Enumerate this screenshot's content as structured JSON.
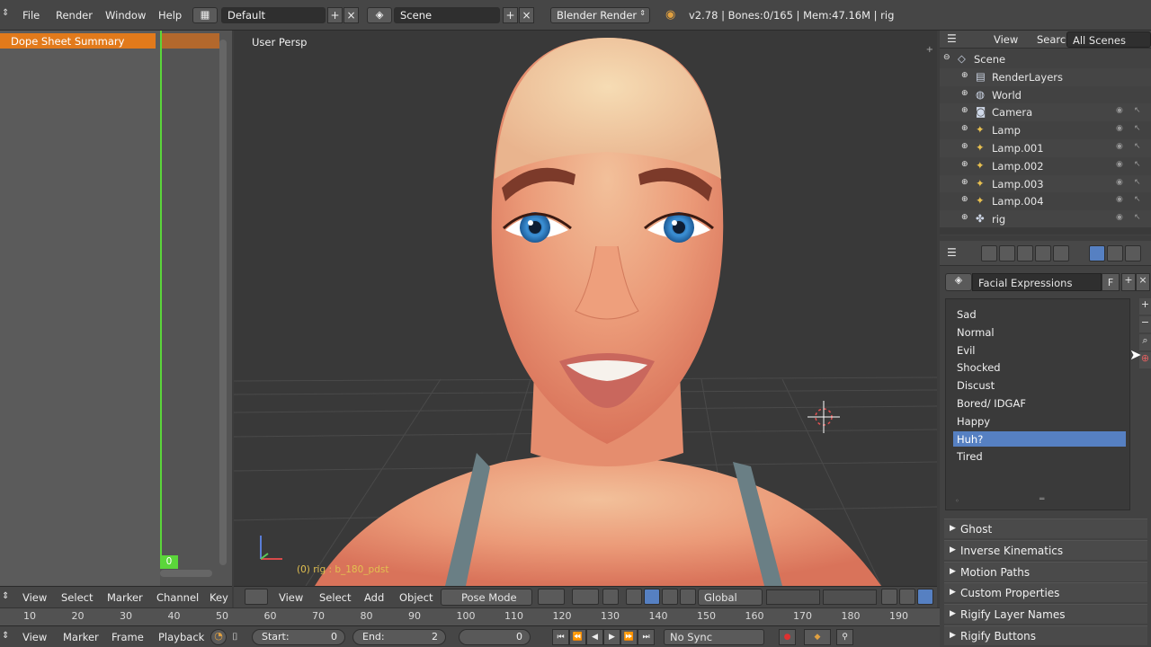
{
  "topbar": {
    "menus": [
      "File",
      "Render",
      "Window",
      "Help"
    ],
    "layout": "Default",
    "scene": "Scene",
    "engine": "Blender Render",
    "stats": "v2.78 | Bones:0/165 | Mem:47.16M | rig"
  },
  "dopesheet": {
    "summary": "Dope Sheet Summary",
    "current_frame": "0",
    "header": [
      "View",
      "Select",
      "Marker",
      "Channel",
      "Key"
    ]
  },
  "viewport": {
    "label": "User Persp",
    "bone_label": "(0) rig : b_180_pdst",
    "header": [
      "View",
      "Select",
      "Add",
      "Object"
    ],
    "mode": "Pose Mode",
    "orientation": "Global"
  },
  "outliner": {
    "header": [
      "View",
      "Search"
    ],
    "display_mode": "All Scenes",
    "items": [
      {
        "name": "Scene",
        "icon": "scene-icon",
        "indent": 0
      },
      {
        "name": "RenderLayers",
        "icon": "renderlayers-icon",
        "indent": 1
      },
      {
        "name": "World",
        "icon": "world-icon",
        "indent": 1
      },
      {
        "name": "Camera",
        "icon": "camera-icon",
        "indent": 1
      },
      {
        "name": "Lamp",
        "icon": "lamp-icon",
        "indent": 1
      },
      {
        "name": "Lamp.001",
        "icon": "lamp-icon",
        "indent": 1
      },
      {
        "name": "Lamp.002",
        "icon": "lamp-icon",
        "indent": 1
      },
      {
        "name": "Lamp.003",
        "icon": "lamp-icon",
        "indent": 1
      },
      {
        "name": "Lamp.004",
        "icon": "lamp-icon",
        "indent": 1
      },
      {
        "name": "rig",
        "icon": "armature-icon",
        "indent": 1
      }
    ]
  },
  "properties": {
    "pose_library": "Facial Expressions",
    "fake_user": "F",
    "poses": [
      "Sad",
      "Normal",
      "Evil",
      "Shocked",
      "Discust",
      "Bored/ IDGAF",
      "Happy",
      "Huh?",
      "Tired"
    ],
    "selected_pose": "Huh?",
    "panels": [
      "Ghost",
      "Inverse Kinematics",
      "Motion Paths",
      "Custom Properties",
      "Rigify Layer Names",
      "Rigify Buttons"
    ]
  },
  "ruler": [
    "10",
    "20",
    "30",
    "40",
    "50",
    "60",
    "70",
    "80",
    "90",
    "100",
    "110",
    "120",
    "130",
    "140",
    "150",
    "160",
    "170",
    "180",
    "190"
  ],
  "timeline": {
    "menus": [
      "View",
      "Marker",
      "Frame",
      "Playback"
    ],
    "start_label": "Start:",
    "start_value": "0",
    "end_label": "End:",
    "end_value": "2",
    "current_value": "0",
    "sync": "No Sync"
  },
  "colors": {
    "accent_selection": "#5680c2",
    "summary_orange": "#e27a1b",
    "playhead_green": "#5bd63a"
  }
}
